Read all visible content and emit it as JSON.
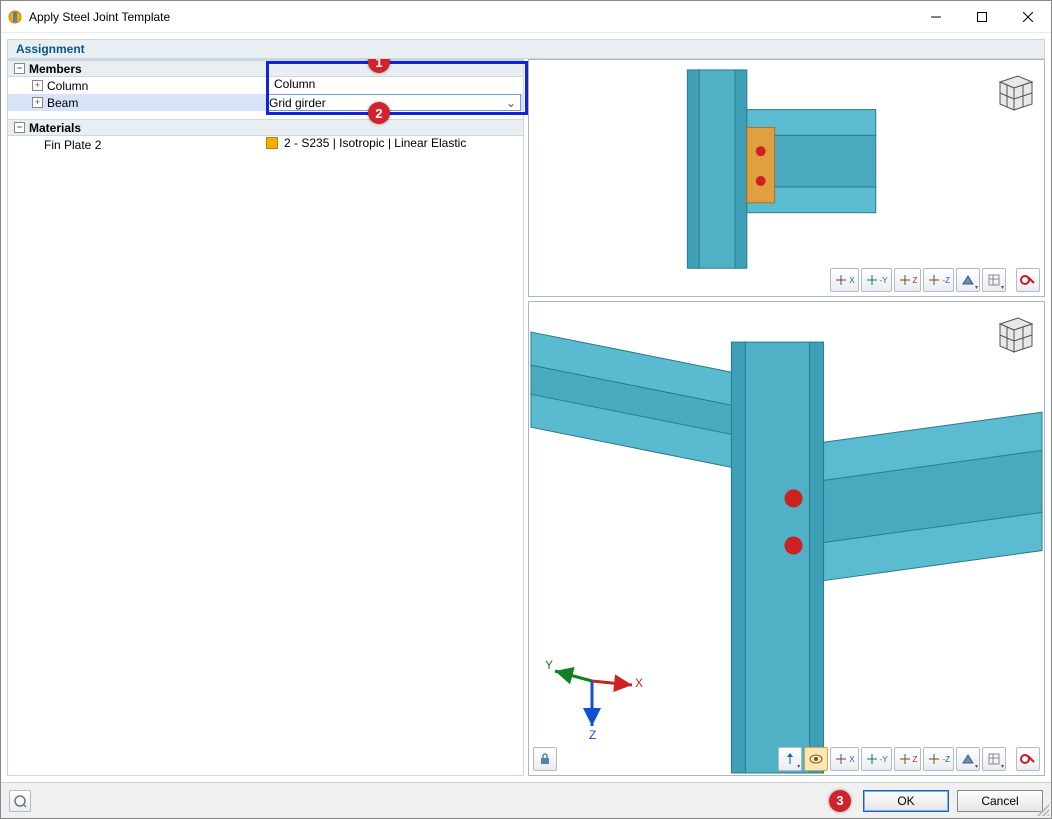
{
  "window": {
    "title": "Apply Steel Joint Template"
  },
  "section_header": "Assignment",
  "tree": {
    "members_label": "Members",
    "column_label": "Column",
    "beam_label": "Beam",
    "materials_label": "Materials",
    "fin_plate_label": "Fin Plate 2"
  },
  "values": {
    "column_value": "Column",
    "beam_value": "Grid girder",
    "fin_plate_value": "2 - S235 | Isotropic | Linear Elastic"
  },
  "callouts": {
    "c1": "1",
    "c2": "2",
    "c3": "3"
  },
  "axes": {
    "x": "X",
    "y": "Y",
    "z": "Z"
  },
  "toolbar": {
    "xy_icon": "X",
    "xz_icon": "-Y",
    "yz_icon": "Z",
    "mz_icon": "-Z"
  },
  "footer": {
    "ok": "OK",
    "cancel": "Cancel"
  }
}
